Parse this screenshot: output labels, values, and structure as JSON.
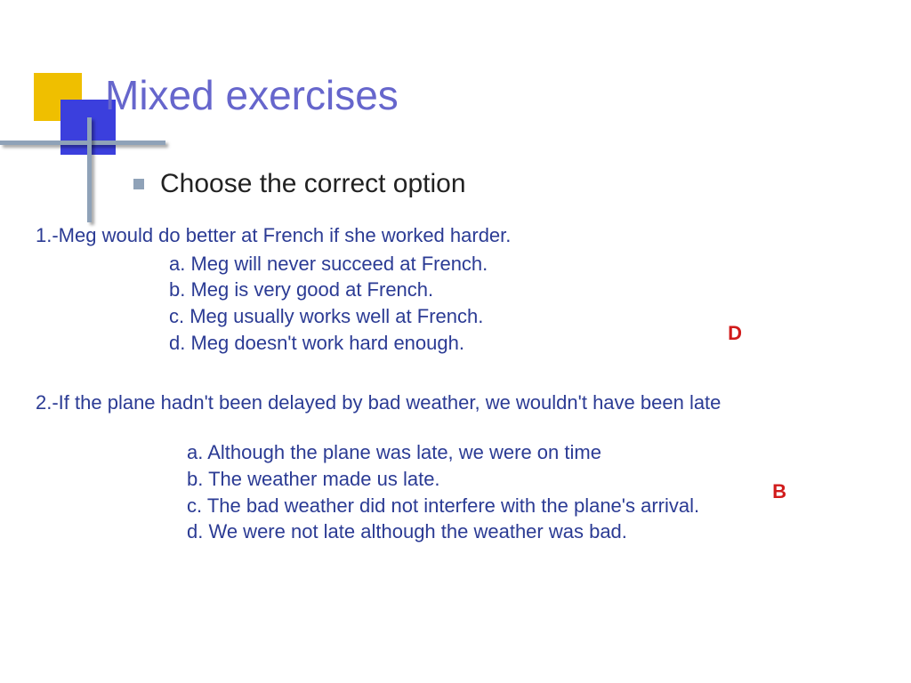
{
  "title": "Mixed exercises",
  "subtitle": "Choose the correct option",
  "q1": {
    "stem": "1.-Meg would do better at French if she worked harder.",
    "opts": {
      "a": "a. Meg will never succeed at French.",
      "b": "b. Meg is very good at French.",
      "c": "c. Meg usually works well at French.",
      "d": "d. Meg doesn't work hard enough."
    },
    "answer": "D"
  },
  "q2": {
    "stem": "2.-If the plane hadn't been delayed by bad weather, we wouldn't have been late",
    "opts": {
      "a": "a. Although the plane was late, we were on time",
      "b": "b. The weather made us late.",
      "c": " c. The bad weather did not interfere with the plane's arrival.",
      "d": "d. We were not late although the weather was bad."
    },
    "answer": "B"
  }
}
